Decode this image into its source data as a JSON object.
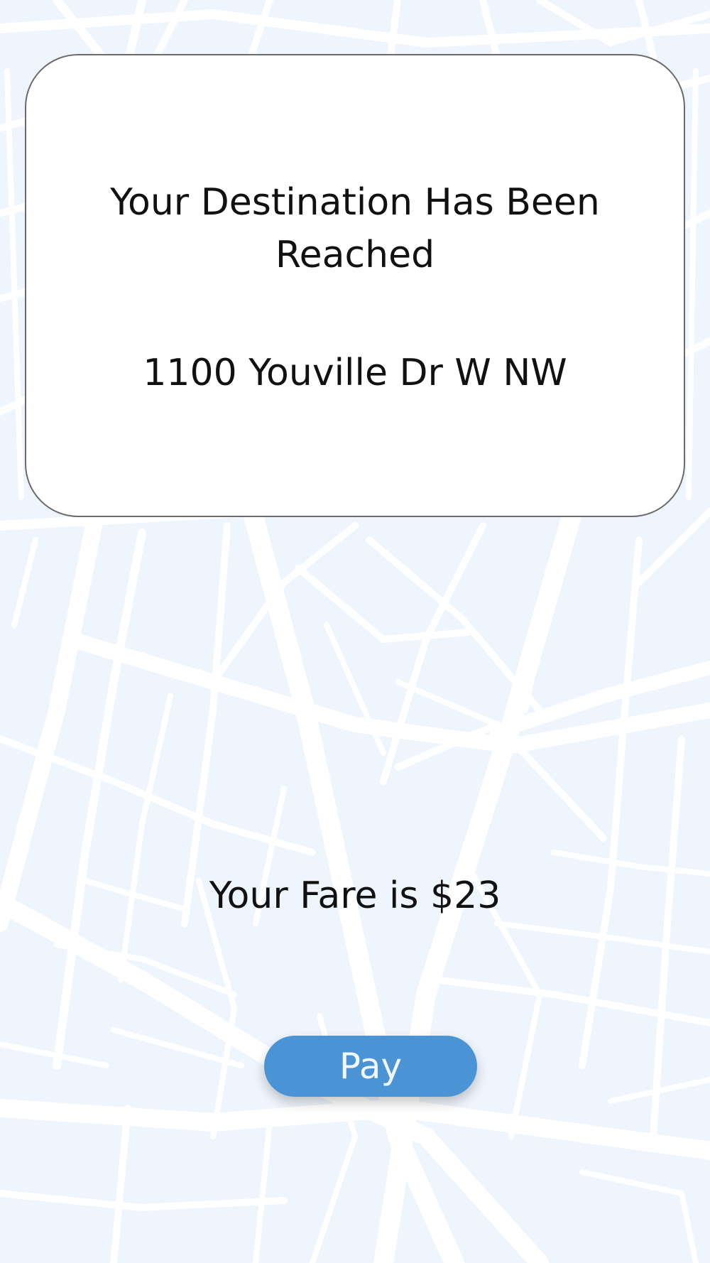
{
  "card": {
    "title": "Your Destination Has Been Reached",
    "address": "1100 Youville Dr W NW"
  },
  "fare": {
    "text": "Your Fare is $23"
  },
  "actions": {
    "pay_label": "Pay"
  },
  "colors": {
    "map_background": "#eef5fc",
    "map_roads": "#ffffff",
    "card_background": "#ffffff",
    "card_border": "#6b6b6b",
    "pay_button": "#4a94d6",
    "pay_label": "#f2f7fc",
    "text": "#111111"
  }
}
